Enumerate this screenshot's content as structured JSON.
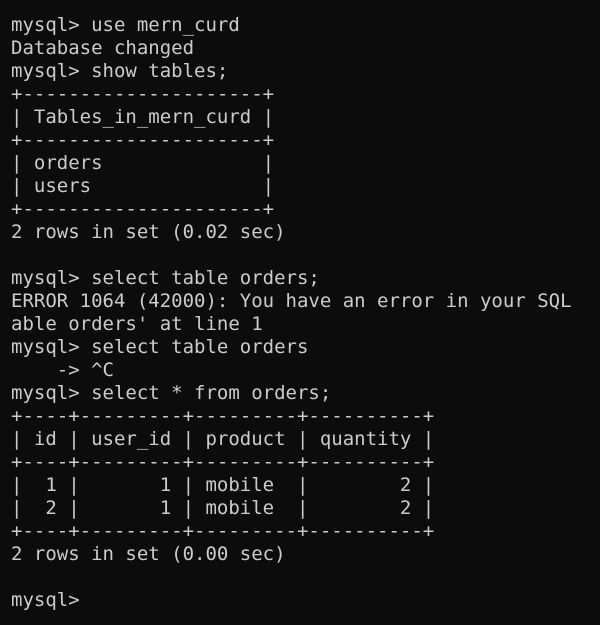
{
  "terminal": {
    "lines": [
      "mysql> use mern_curd",
      "Database changed",
      "mysql> show tables;",
      "+---------------------+",
      "| Tables_in_mern_curd |",
      "+---------------------+",
      "| orders              |",
      "| users               |",
      "+---------------------+",
      "2 rows in set (0.02 sec)",
      "",
      "mysql> select table orders;",
      "ERROR 1064 (42000): You have an error in your SQL",
      "able orders' at line 1",
      "mysql> select table orders",
      "    -> ^C",
      "mysql> select * from orders;",
      "+----+---------+---------+----------+",
      "| id | user_id | product | quantity |",
      "+----+---------+---------+----------+",
      "|  1 |       1 | mobile  |        2 |",
      "|  2 |       1 | mobile  |        2 |",
      "+----+---------+---------+----------+",
      "2 rows in set (0.00 sec)",
      "",
      "mysql>"
    ]
  }
}
